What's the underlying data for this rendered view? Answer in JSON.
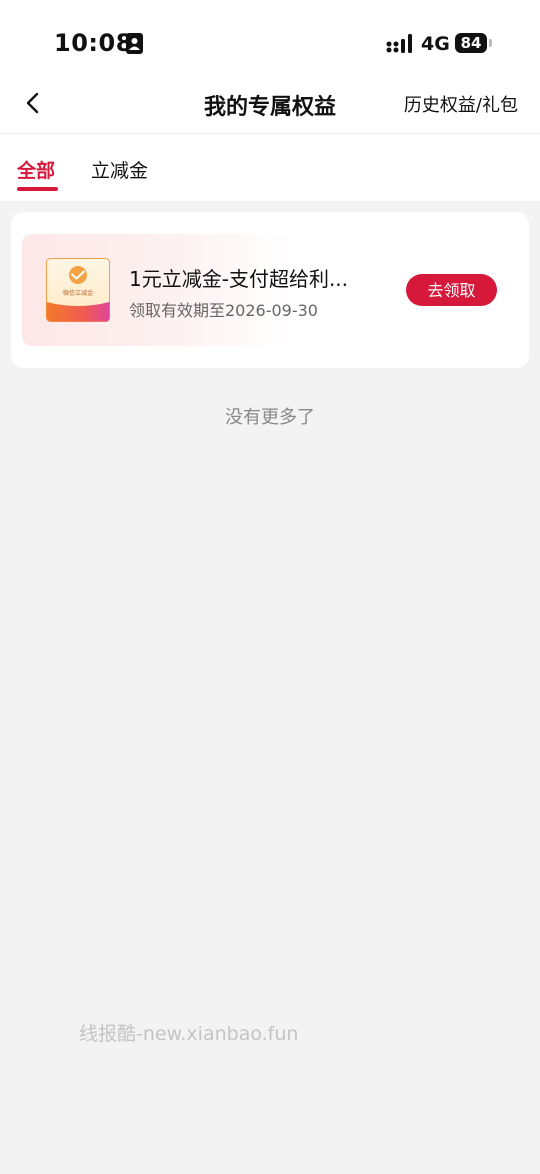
{
  "status_bar": {
    "time": "10:08",
    "network": "4G",
    "battery": "84"
  },
  "nav": {
    "title": "我的专属权益",
    "history_link": "历史权益/礼包"
  },
  "tabs": [
    {
      "label": "全部",
      "active": true
    },
    {
      "label": "立减金",
      "active": false
    }
  ],
  "coupons": [
    {
      "name": "1元立减金-支付超给利...",
      "expiry": "领取有效期至2026-09-30",
      "action_label": "去领取",
      "thumb_label": "·微信立减金·"
    }
  ],
  "list_end_text": "没有更多了",
  "watermark": "线报酷-new.xianbao.fun",
  "colors": {
    "accent": "#d6193b",
    "background": "#f3f3f3",
    "card": "#ffffff"
  }
}
